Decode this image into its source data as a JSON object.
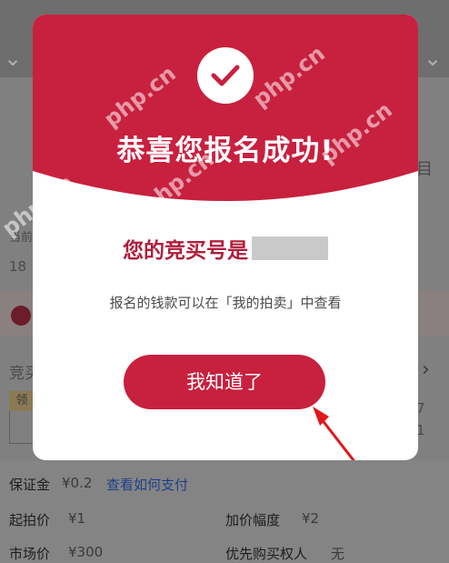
{
  "modal": {
    "title": "恭喜您报名成功!",
    "bid_number_label": "您的竞买号是",
    "info": "报名的钱款可以在「我的拍卖」中查看",
    "confirm_button": "我知道了"
  },
  "background": {
    "partial_left_1": "当前",
    "partial_left_2": "18",
    "partial_left_3": "竞买",
    "tag": "领",
    "partial_right_1": "7",
    "partial_right_2": "1",
    "partial_right_3": "目"
  },
  "details": {
    "deposit_label": "保证金",
    "deposit_value": "¥0.2",
    "pay_link": "查看如何支付",
    "start_price_label": "起拍价",
    "start_price_value": "¥1",
    "increment_label": "加价幅度",
    "increment_value": "¥2",
    "market_price_label": "市场价",
    "market_price_value": "¥300",
    "priority_label": "优先购买权人",
    "priority_value": "无"
  },
  "watermark": "php.cn",
  "colors": {
    "accent": "#c8203f",
    "bid_text": "#b01e3c",
    "link": "#1f3f8a"
  }
}
